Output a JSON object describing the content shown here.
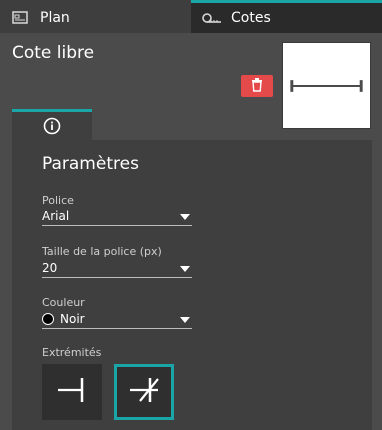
{
  "tabs": [
    {
      "label": "Plan",
      "icon": "plan-icon"
    },
    {
      "label": "Cotes",
      "icon": "cotes-icon"
    }
  ],
  "panel": {
    "title": "Cote libre",
    "delete_icon": "trash-icon",
    "info_icon": "info-icon"
  },
  "parametres": {
    "title": "Paramètres",
    "police": {
      "label": "Police",
      "value": "Arial"
    },
    "taille": {
      "label": "Taille de la police (px)",
      "value": "20"
    },
    "couleur": {
      "label": "Couleur",
      "value": "Noir",
      "swatch": "#000000"
    },
    "extremites": {
      "label": "Extrémités"
    }
  },
  "colors": {
    "accent": "#1aa6a6",
    "danger": "#e44a4a"
  }
}
